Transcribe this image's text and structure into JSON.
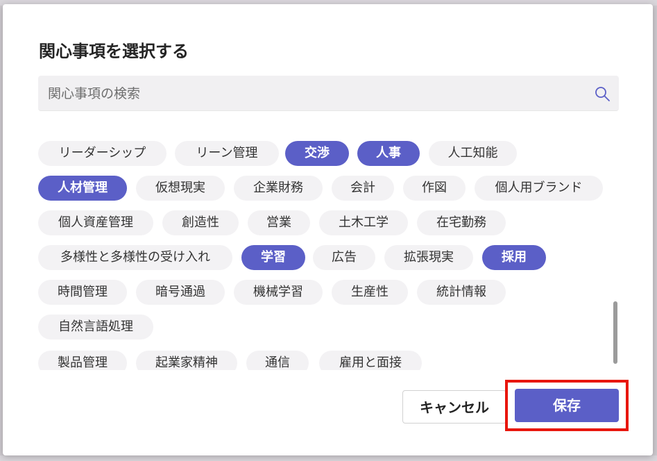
{
  "dialog": {
    "title": "関心事項を選択する",
    "search": {
      "placeholder": "関心事項の検索",
      "value": "",
      "icon": "search-icon"
    },
    "chips": [
      {
        "label": "リーダーシップ",
        "selected": false
      },
      {
        "label": "リーン管理",
        "selected": false
      },
      {
        "label": "交渉",
        "selected": true
      },
      {
        "label": "人事",
        "selected": true
      },
      {
        "label": "人工知能",
        "selected": false
      },
      {
        "label": "人材管理",
        "selected": true
      },
      {
        "label": "仮想現実",
        "selected": false
      },
      {
        "label": "企業財務",
        "selected": false
      },
      {
        "label": "会計",
        "selected": false
      },
      {
        "label": "作図",
        "selected": false
      },
      {
        "label": "個人用ブランド",
        "selected": false
      },
      {
        "label": "個人資産管理",
        "selected": false
      },
      {
        "label": "創造性",
        "selected": false
      },
      {
        "label": "営業",
        "selected": false
      },
      {
        "label": "土木工学",
        "selected": false
      },
      {
        "label": "在宅勤務",
        "selected": false
      },
      {
        "label": "多様性と多様性の受け入れ",
        "selected": false
      },
      {
        "label": "学習",
        "selected": true
      },
      {
        "label": "広告",
        "selected": false
      },
      {
        "label": "拡張現実",
        "selected": false
      },
      {
        "label": "採用",
        "selected": true
      },
      {
        "label": "時間管理",
        "selected": false
      },
      {
        "label": "暗号通過",
        "selected": false
      },
      {
        "label": "機械学習",
        "selected": false
      },
      {
        "label": "生産性",
        "selected": false
      },
      {
        "label": "統計情報",
        "selected": false
      },
      {
        "label": "自然言語処理",
        "selected": false
      },
      {
        "label": "製品管理",
        "selected": false
      },
      {
        "label": "起業家精神",
        "selected": false
      },
      {
        "label": "通信",
        "selected": false
      },
      {
        "label": "雇用と面接",
        "selected": false
      }
    ],
    "buttons": {
      "cancel": "キャンセル",
      "save": "保存"
    },
    "colors": {
      "accent": "#5b5fc7",
      "highlight": "#e8160c"
    }
  }
}
